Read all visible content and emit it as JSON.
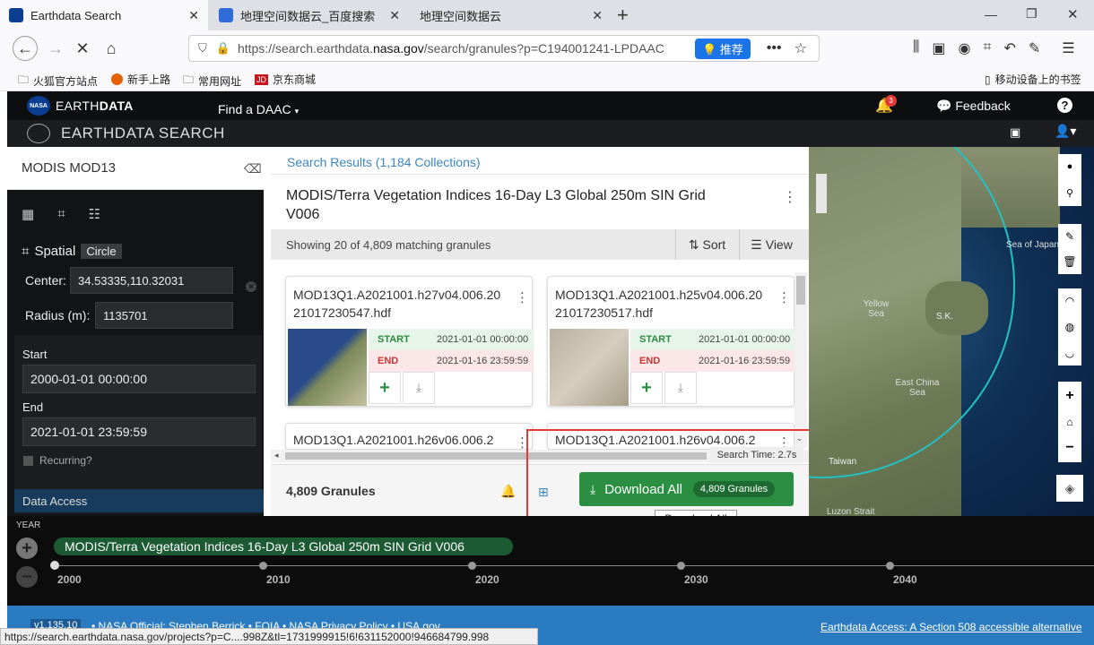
{
  "browser": {
    "tabs": [
      {
        "title": "Earthdata Search",
        "active": true
      },
      {
        "title": "地理空间数据云_百度搜索",
        "active": false
      },
      {
        "title": "地理空间数据云",
        "active": false
      }
    ],
    "url_prefix": "https://search.earthdata.",
    "url_domain": "nasa.gov",
    "url_rest": "/search/granules?p=C194001241-LPDAAC",
    "recommend_label": "推荐",
    "bookmarks": [
      "火狐官方站点",
      "新手上路",
      "常用网址",
      "京东商城"
    ],
    "mobile_bookmarks": "移动设备上的书签"
  },
  "earthdata": {
    "nasa_badge": "NASA",
    "brand_a": "EARTH",
    "brand_b": "DATA",
    "find_daac": "Find a DAAC",
    "notif_count": "3",
    "feedback": "Feedback",
    "help": "?",
    "search_brand_a": "EARTHDATA",
    "search_brand_b": "SEARCH"
  },
  "sidebar": {
    "search_text": "MODIS MOD13",
    "spatial_label": "Spatial",
    "spatial_type": "Circle",
    "center_label": "Center:",
    "center_value": "34.53335,110.32031",
    "radius_label": "Radius (m):",
    "radius_value": "1135701",
    "start_label": "Start",
    "start_value": "2000-01-01 00:00:00",
    "end_label": "End",
    "end_value": "2021-01-01 23:59:59",
    "recurring_label": "Recurring?",
    "data_access": "Data Access"
  },
  "results": {
    "breadcrumb": "Search Results (1,184 Collections)",
    "collection_title": "MODIS/Terra Vegetation Indices 16-Day L3 Global 250m SIN Grid V006",
    "showing": "Showing 20 of 4,809 matching granules",
    "sort_label": "Sort",
    "view_label": "View",
    "start_tag": "START",
    "end_tag": "END",
    "granules": [
      {
        "name": "MOD13Q1.A2021001.h27v04.006.2021017230547.hdf",
        "start": "2021-01-01 00:00:00",
        "end": "2021-01-16 23:59:59"
      },
      {
        "name": "MOD13Q1.A2021001.h25v04.006.2021017230517.hdf",
        "start": "2021-01-01 00:00:00",
        "end": "2021-01-16 23:59:59"
      },
      {
        "name": "MOD13Q1.A2021001.h26v06.006.2"
      },
      {
        "name": "MOD13Q1.A2021001.h26v04.006.2"
      }
    ],
    "search_time": "Search Time: 2.7s",
    "granule_count": "4,809 Granules",
    "download_all": "Download All",
    "download_badge": "4,809 Granules",
    "tooltip": "Download All"
  },
  "map": {
    "labels": [
      "Sea of Japan",
      "Yellow Sea",
      "S.K.",
      "East China Sea",
      "Taiwan",
      "Luzon Strait"
    ]
  },
  "timeline": {
    "year_label": "YEAR",
    "collection": "MODIS/Terra Vegetation Indices 16-Day L3 Global 250m SIN Grid V006",
    "years": [
      "2000",
      "2010",
      "2020",
      "2030",
      "2040"
    ]
  },
  "footer": {
    "version": "v1.135.10",
    "official": "NASA Official: Stephen Berrick",
    "foia": "FOIA",
    "privacy": "NASA Privacy Policy",
    "usa": "USA.gov",
    "access": "Earthdata Access: A Section 508 accessible alternative"
  },
  "status_url": "https://search.earthdata.nasa.gov/projects?p=C....998Z&tl=1731999915!6!631152000!946684799.998",
  "colors": {
    "download_green": "#2a8f42",
    "nasa_blue": "#0b3d91",
    "highlight_red": "#e53935",
    "footer_blue": "#2b7bc0"
  }
}
